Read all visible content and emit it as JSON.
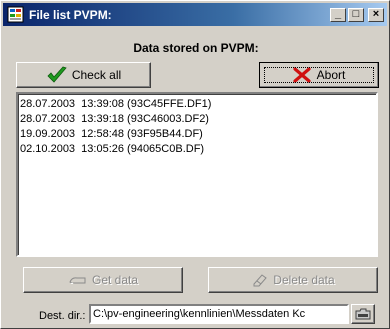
{
  "window": {
    "title": "File list PVPM:"
  },
  "titlebar_buttons": {
    "minimize": "_",
    "maximize": "□",
    "close": "×"
  },
  "heading": "Data stored on PVPM:",
  "toolbar": {
    "check_all_label": "Check all",
    "abort_label": "Abort"
  },
  "files": [
    "28.07.2003  13:39:08 (93C45FFE.DF1)",
    "28.07.2003  13:39:18 (93C46003.DF2)",
    "19.09.2003  12:58:48 (93F95B44.DF)",
    "02.10.2003  13:05:26 (94065C0B.DF)"
  ],
  "actions": {
    "get_data_label": "Get data",
    "delete_data_label": "Delete data"
  },
  "dest": {
    "label": "Dest. dir.:",
    "path": "C:\\pv-engineering\\kennlinien\\Messdaten Kc"
  },
  "colors": {
    "check": "#1f9a1f",
    "abort_x": "#d01010",
    "titlebar": "#0a246a"
  }
}
